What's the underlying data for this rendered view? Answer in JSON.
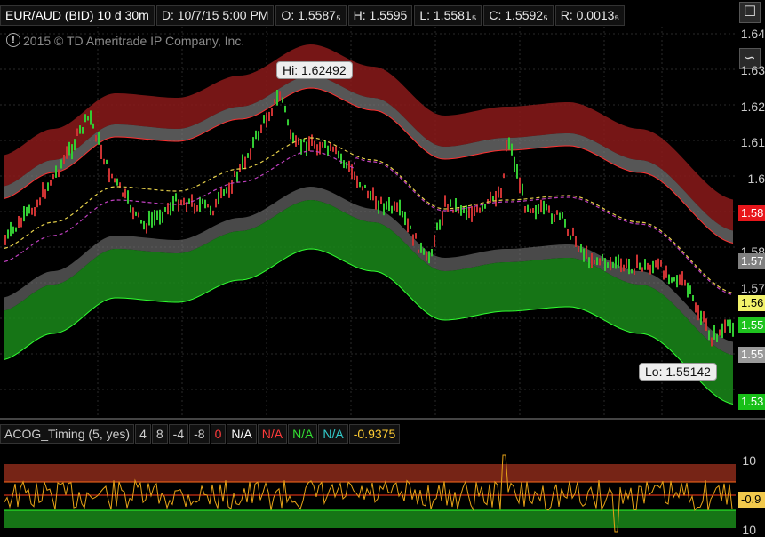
{
  "header": {
    "symbol": "EUR/AUD (BID) 10 d 30m",
    "date": "D: 10/7/15 5:00 PM",
    "open": "O: 1.5587₅",
    "high": "H: 1.5595",
    "low": "L: 1.5581₅",
    "close": "C: 1.5592₅",
    "range": "R: 0.0013₅"
  },
  "copyright": "2015 © TD Ameritrade IP Company, Inc.",
  "hi_label": "Hi: 1.62492",
  "lo_label": "Lo: 1.55142",
  "price_axis": [
    "1.64",
    "1.63",
    "1.62",
    "1.61",
    "1.6",
    "1.58",
    "1.57"
  ],
  "badges": [
    {
      "text": "1.58",
      "bg": "#e8161b",
      "fg": "#ffffff"
    },
    {
      "text": "1.57",
      "bg": "#808080",
      "fg": "#ffffff"
    },
    {
      "text": "1.56",
      "bg": "#f2f26a",
      "fg": "#000000"
    },
    {
      "text": "1.55",
      "bg": "#1ec31e",
      "fg": "#ffffff"
    },
    {
      "text": "1.55",
      "bg": "#9a9a9a",
      "fg": "#ffffff"
    },
    {
      "text": "1.53",
      "bg": "#18c018",
      "fg": "#ffffff"
    }
  ],
  "indicator": {
    "name": "ACOG_Timing (5, yes)",
    "params": [
      "4",
      "8",
      "-4",
      "-8"
    ],
    "values": [
      {
        "text": "0",
        "color": "#ff3b3b"
      },
      {
        "text": "N/A",
        "color": "#ffffff"
      },
      {
        "text": "N/A",
        "color": "#ff3b3b"
      },
      {
        "text": "N/A",
        "color": "#33dd33"
      },
      {
        "text": "N/A",
        "color": "#33cccc"
      },
      {
        "text": "-0.9375",
        "color": "#ffcc33"
      }
    ],
    "axis": [
      "10",
      "10"
    ],
    "badge": "-0.9"
  },
  "colors": {
    "upper_band": "#8b1a1a",
    "lower_band": "#1a7a1a",
    "mid_band": "#8a8a8a",
    "osc_line": "#e8a317"
  }
}
